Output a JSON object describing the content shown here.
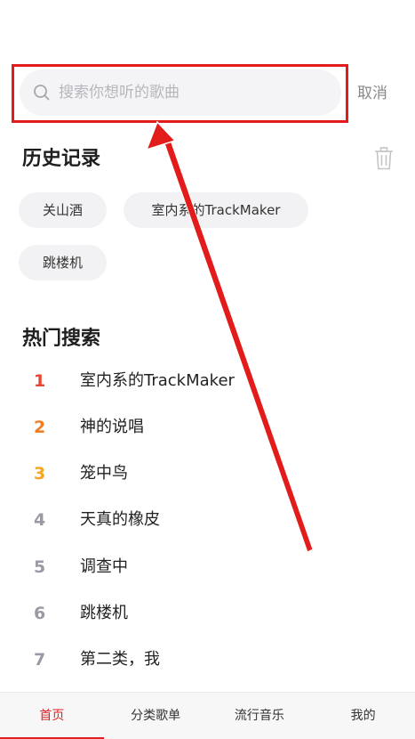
{
  "search": {
    "placeholder": "搜索你想听的歌曲",
    "cancel_label": "取消"
  },
  "history": {
    "title": "历史记录",
    "items": [
      "关山酒",
      "室内系的TrackMaker",
      "跳楼机"
    ]
  },
  "hot_search": {
    "title": "热门搜索",
    "items": [
      {
        "rank": "1",
        "text": "室内系的TrackMaker"
      },
      {
        "rank": "2",
        "text": "神的说唱"
      },
      {
        "rank": "3",
        "text": "笼中鸟"
      },
      {
        "rank": "4",
        "text": "天真的橡皮"
      },
      {
        "rank": "5",
        "text": "调查中"
      },
      {
        "rank": "6",
        "text": "跳楼机"
      },
      {
        "rank": "7",
        "text": "第二类，我"
      }
    ],
    "rank_colors": [
      "#e8452e",
      "#f07c22",
      "#f5a623",
      "#9a9aa6",
      "#9a9aa6",
      "#9a9aa6",
      "#9a9aa6"
    ]
  },
  "tabbar": {
    "tabs": [
      "首页",
      "分类歌单",
      "流行音乐",
      "我的"
    ],
    "active": "首页"
  },
  "colors": {
    "accent": "#e02020",
    "highlight": "#e21b1b"
  }
}
